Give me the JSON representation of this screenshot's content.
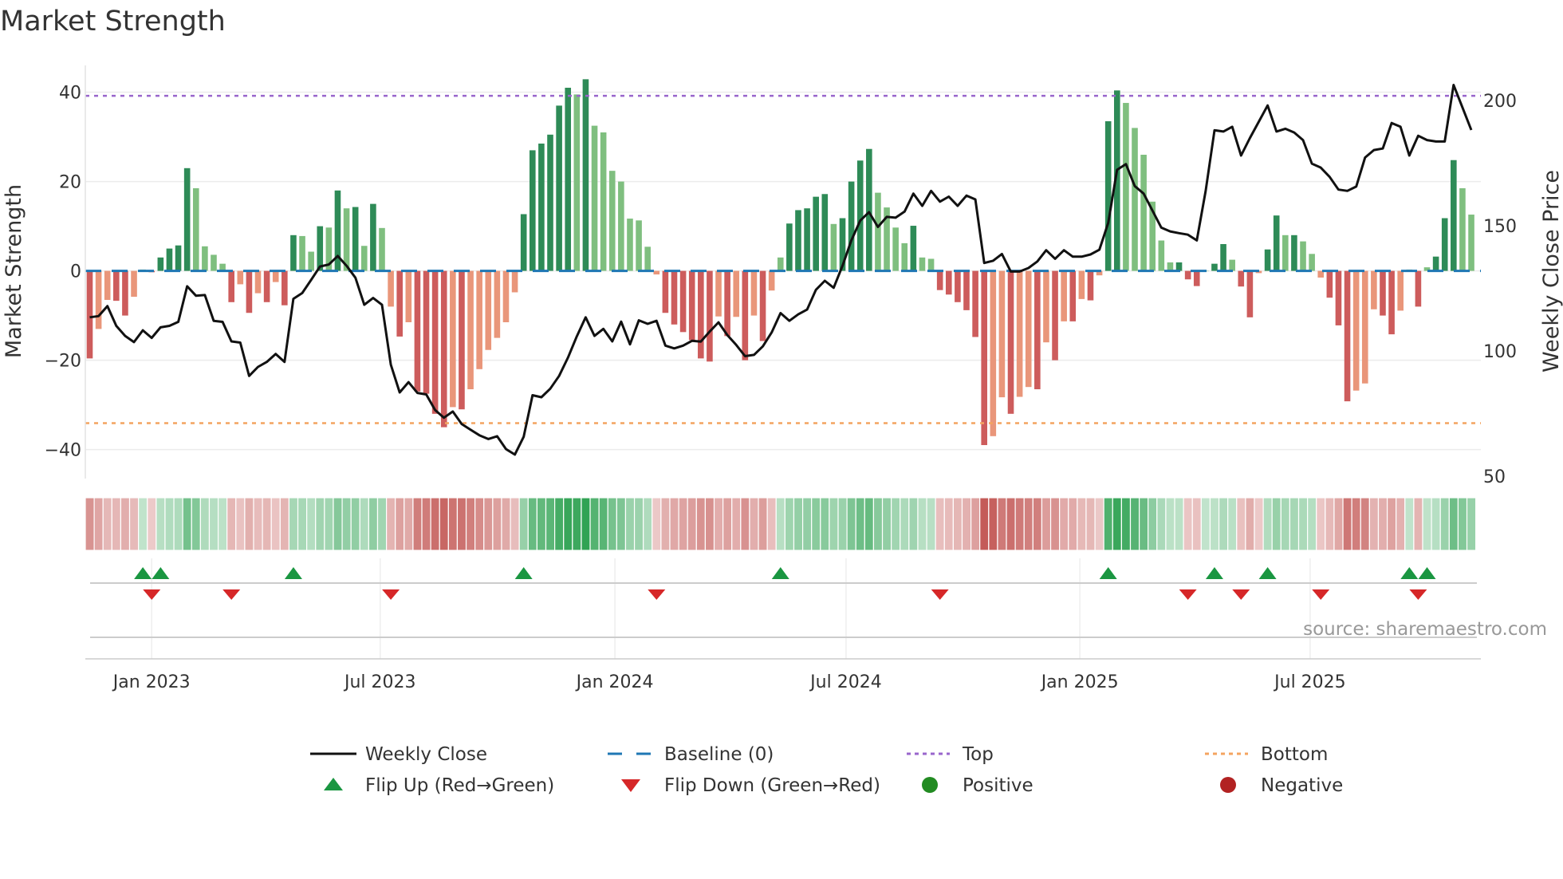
{
  "title": "Market Strength",
  "source": "source: sharemaestro.com",
  "chart_data": {
    "type": "bar",
    "title": "Market Strength",
    "ylabel": "Market Strength",
    "y2label": "Weekly Close Price",
    "ylim": [
      -46.5,
      46
    ],
    "y2lim": [
      49,
      214
    ],
    "yticks": [
      40,
      20,
      0,
      -20,
      -40
    ],
    "yticklabels": [
      "40",
      "20",
      "0",
      "−20",
      "−40"
    ],
    "y2ticks": [
      200,
      150,
      100,
      50
    ],
    "y2ticklabels": [
      "200",
      "150",
      "100",
      "50"
    ],
    "xticks": [
      {
        "week": 7,
        "label": "Jan 2023"
      },
      {
        "week": 32.8,
        "label": "Jul 2023"
      },
      {
        "week": 59.3,
        "label": "Jan 2024"
      },
      {
        "week": 85.4,
        "label": "Jul 2024"
      },
      {
        "week": 111.8,
        "label": "Jan 2025"
      },
      {
        "week": 137.8,
        "label": "Jul 2025"
      }
    ],
    "top_level": 39.2,
    "bottom_level": -34.1,
    "strength": [
      -19.6,
      -13,
      -6.5,
      -6.7,
      -10,
      -5.8,
      0.3,
      -0.3,
      3,
      5,
      5.7,
      23,
      18.5,
      5.5,
      3.6,
      1.6,
      -7,
      -3,
      -9.4,
      -5,
      -7,
      -2.5,
      -7.7,
      8,
      7.8,
      4.3,
      10,
      9.7,
      18,
      14,
      14.3,
      5.6,
      15,
      9.6,
      -8,
      -14.7,
      -11.5,
      -27,
      -27.5,
      -32,
      -35,
      -30.5,
      -31,
      -26.5,
      -22,
      -17.7,
      -15,
      -11.5,
      -4.8,
      12.7,
      27,
      28.5,
      30.5,
      37,
      41,
      39.5,
      42.9,
      32.5,
      31,
      22.4,
      20,
      11.7,
      11.3,
      5.4,
      -0.8,
      -9.4,
      -12,
      -13.7,
      -15.5,
      -19.6,
      -20.3,
      -10.2,
      -14.6,
      -10.3,
      -20,
      -10,
      -15.7,
      -4.4,
      3,
      10.6,
      13.6,
      14,
      16.6,
      17.2,
      10.5,
      11.8,
      20,
      24.7,
      27.3,
      17.5,
      14.2,
      9.7,
      6.2,
      10.1,
      3,
      2.7,
      -4.3,
      -5.3,
      -7,
      -8.8,
      -14.8,
      -39,
      -37,
      -28.3,
      -32,
      -28.2,
      -26,
      -26.5,
      -16,
      -20,
      -11.3,
      -11.3,
      -6.3,
      -6.6,
      -1,
      33.5,
      40.4,
      37.6,
      32,
      26,
      15.5,
      6.8,
      1.9,
      1.9,
      -1.9,
      -3.4,
      0,
      1.6,
      6,
      2.5,
      -3.5,
      -10.4,
      -0.5,
      4.8,
      12.4,
      8,
      8,
      6.6,
      3.8,
      -1.5,
      -6,
      -12.2,
      -29.2,
      -26.8,
      -25.2,
      -8.6,
      -10,
      -14.2,
      -8.9,
      0.3,
      -8,
      0.8,
      3.2,
      11.8,
      24.8,
      18.5,
      12.6
    ],
    "weekly_close": [
      113.4,
      113.9,
      117.9,
      110,
      106,
      103.5,
      108.2,
      105.2,
      109.4,
      110,
      111.6,
      125.8,
      122,
      122.3,
      112,
      111.6,
      103.8,
      103.3,
      90,
      93.6,
      95.6,
      98.8,
      95.6,
      120.8,
      123.1,
      128.3,
      133.7,
      134.5,
      137.9,
      134,
      129.2,
      118.4,
      121.1,
      118.4,
      94.5,
      83.4,
      87.5,
      83.2,
      82.6,
      76.4,
      73.3,
      75.8,
      70.8,
      68.5,
      66.3,
      64.8,
      65.9,
      60.8,
      58.6,
      65.7,
      82.3,
      81.5,
      84.9,
      90,
      97.3,
      105.8,
      113.4,
      106,
      108.8,
      103.8,
      111.7,
      102.6,
      112.2,
      110.8,
      112,
      102.1,
      101,
      102.1,
      104,
      103.7,
      107.7,
      111.4,
      106.3,
      102.4,
      97.9,
      98.4,
      101.8,
      107.4,
      115.1,
      112,
      114.6,
      116.5,
      124.4,
      128,
      125.2,
      134,
      144.1,
      152,
      155.4,
      149.5,
      153.5,
      153.2,
      155.6,
      162.8,
      157.9,
      163.9,
      159.6,
      161.6,
      157.9,
      162,
      160.5,
      135.1,
      136,
      138.7,
      131.7,
      131.7,
      133.1,
      135.7,
      140.2,
      136.8,
      140.2,
      137.6,
      137.6,
      138.5,
      140.4,
      151.1,
      172.3,
      174.6,
      165.8,
      162.8,
      156,
      149.2,
      147.7,
      147,
      146.4,
      144.1,
      163.9,
      188.1,
      187.6,
      189.5,
      178,
      185,
      191.5,
      198,
      187.6,
      188.7,
      187.2,
      184.2,
      174.8,
      173.2,
      169.5,
      164.4,
      163.9,
      165.6,
      177.2,
      180.2,
      180.8,
      191,
      189.5,
      178,
      185.9,
      184.2,
      183.6,
      183.6,
      206.2,
      197.2,
      188.2
    ],
    "flip_up_weeks": [
      6,
      8,
      23,
      49,
      78,
      115,
      127,
      133,
      149,
      151
    ],
    "flip_down_weeks": [
      7,
      16,
      34,
      64,
      96,
      124,
      130,
      139,
      150
    ],
    "legend": [
      {
        "label": "Weekly Close",
        "kind": "line",
        "color": "#111111"
      },
      {
        "label": "Baseline (0)",
        "kind": "dash",
        "color": "#1f77b4"
      },
      {
        "label": "Top",
        "kind": "dot",
        "color": "#9966cc"
      },
      {
        "label": "Bottom",
        "kind": "dot",
        "color": "#f4a460"
      },
      {
        "label": "Flip Up (Red→Green)",
        "kind": "tri-up",
        "color": "#1a9641"
      },
      {
        "label": "Flip Down (Green→Red)",
        "kind": "tri-down",
        "color": "#d62728"
      },
      {
        "label": "Positive",
        "kind": "circle",
        "color": "#228b22"
      },
      {
        "label": "Negative",
        "kind": "circle",
        "color": "#b22222"
      }
    ],
    "legend_placement": "bottom",
    "colors": {
      "pos_dark": "#2e8b57",
      "pos_light": "#7fbf7f",
      "neg_dark": "#cd5c5c",
      "neg_light": "#e9967a",
      "heat_pos": "#31a354",
      "heat_neg": "#c0504d"
    }
  }
}
